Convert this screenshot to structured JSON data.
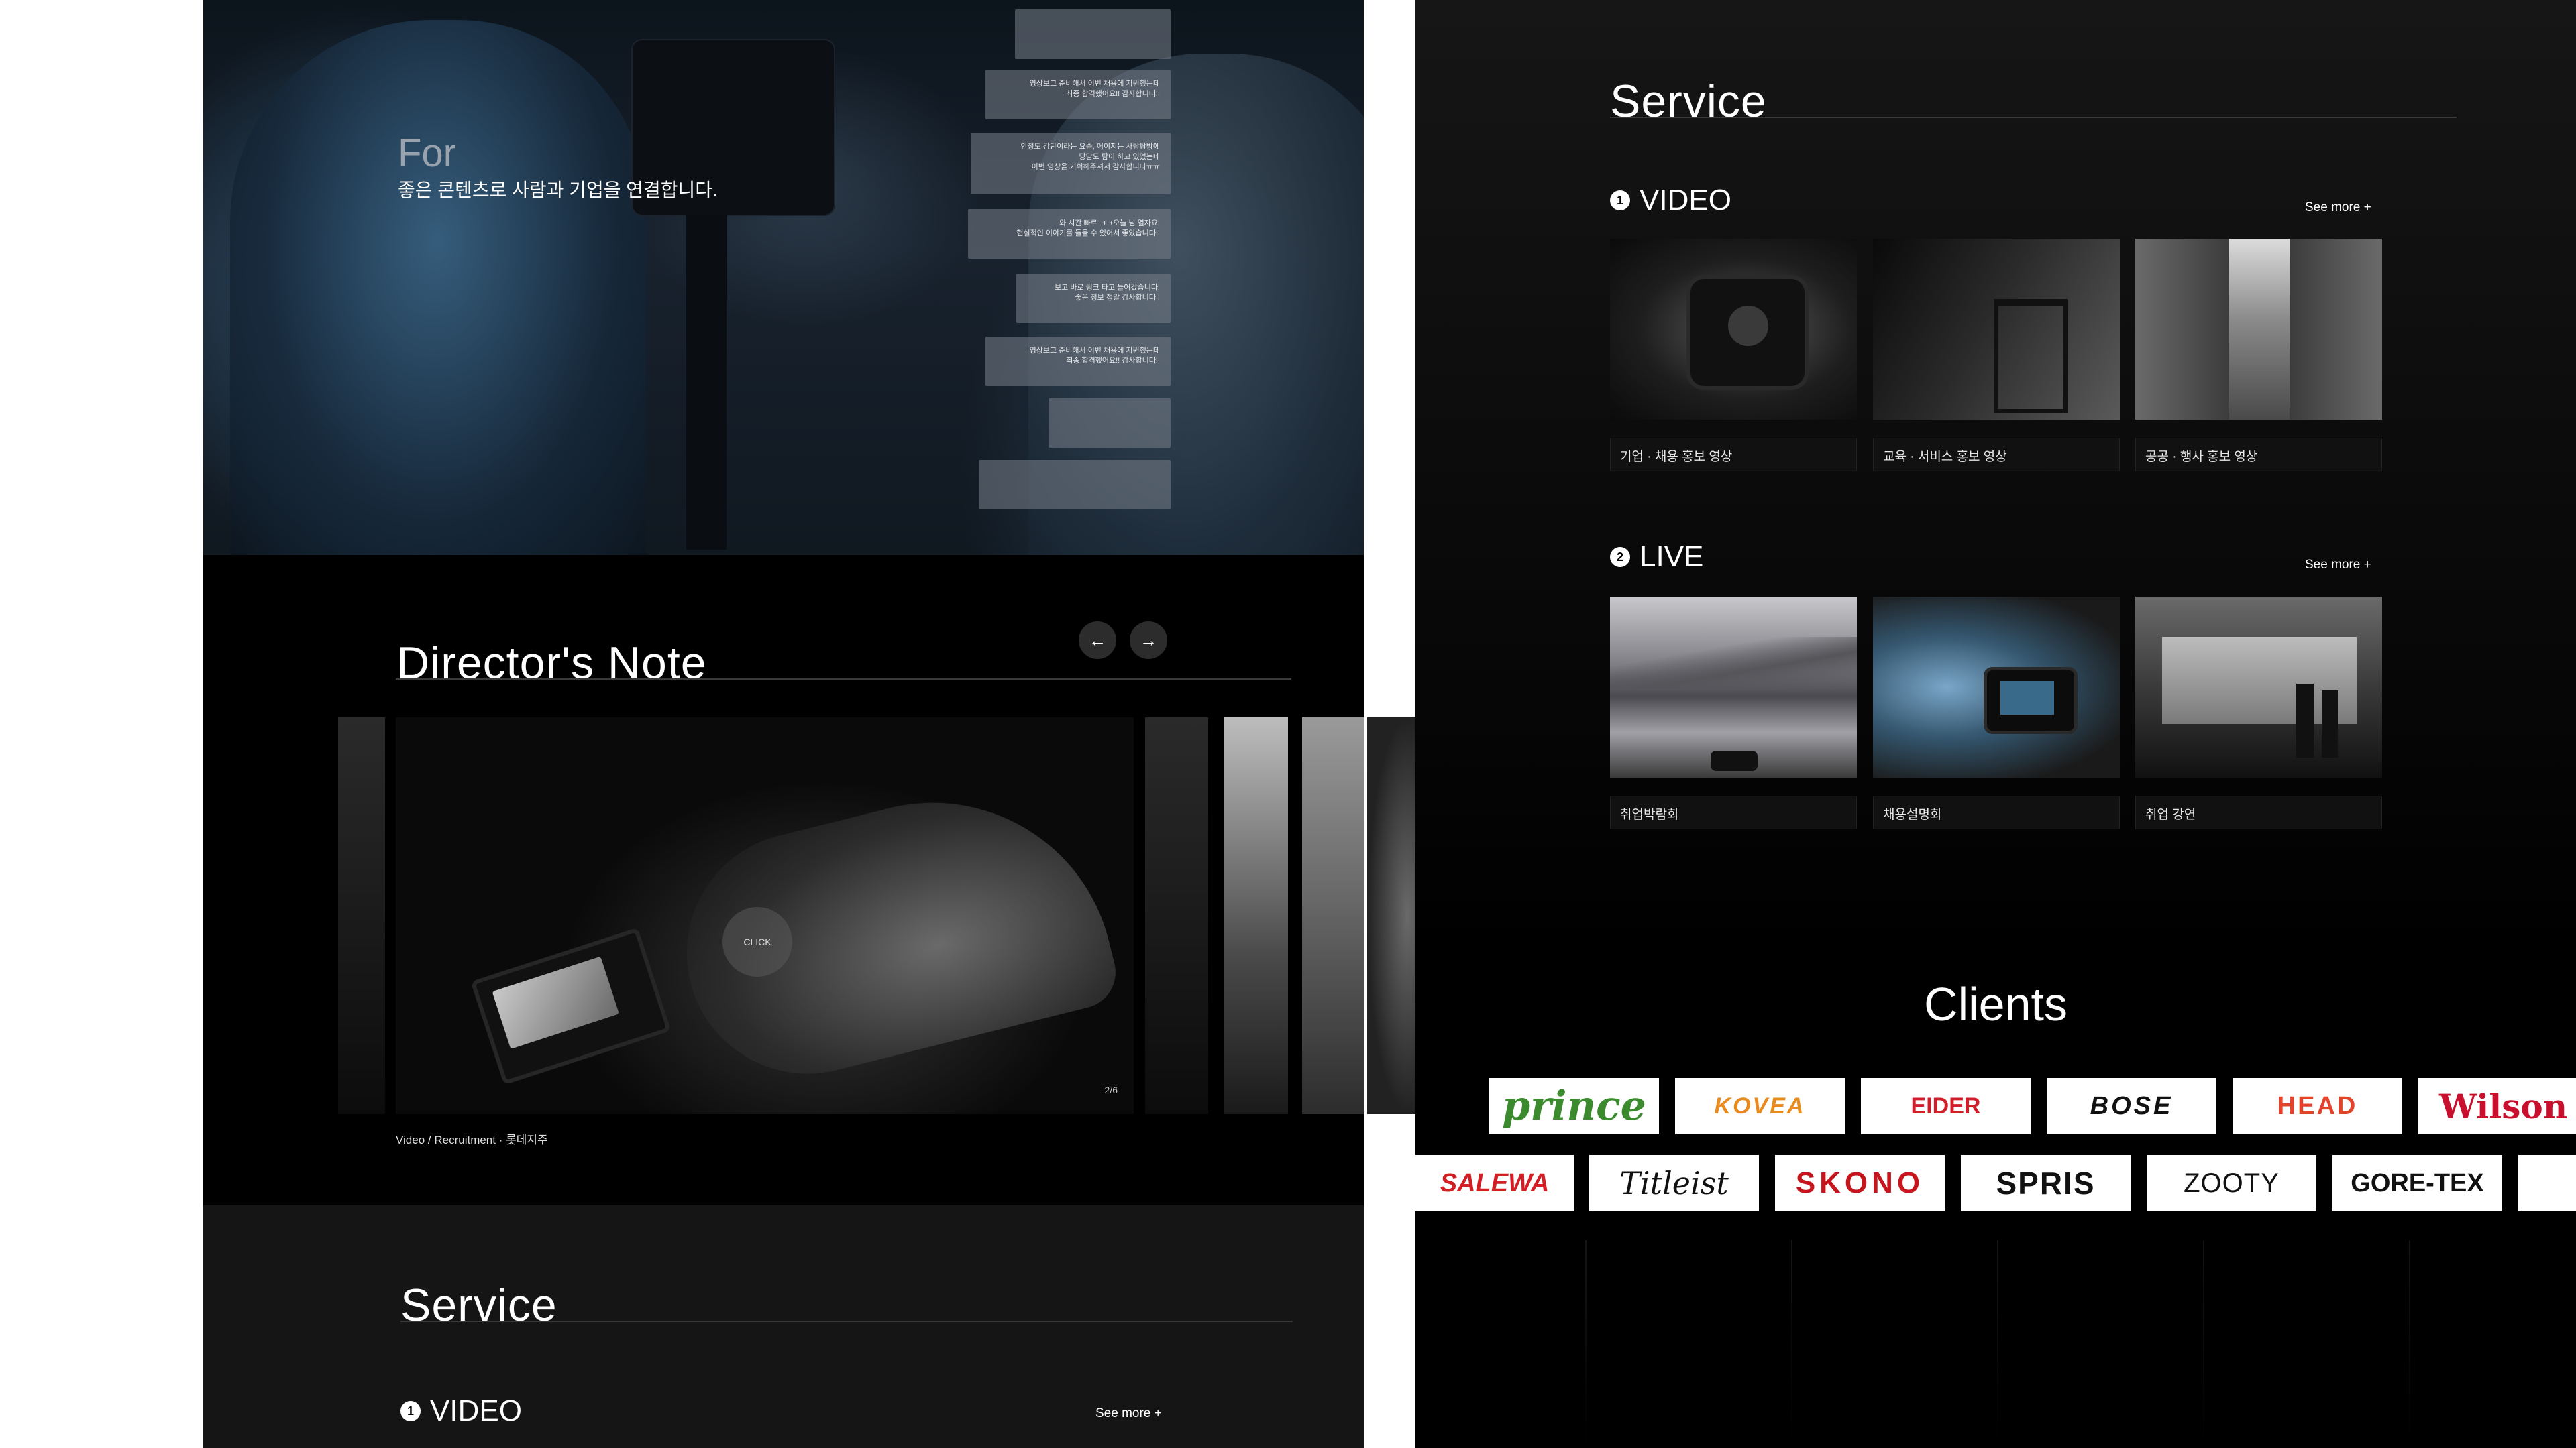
{
  "hero": {
    "for_label": "For",
    "tagline": "좋은 콘텐츠로 사람과 기업을 연결합니다.",
    "bubbles": [
      "영상보고 준비해서 이번 채용에 지원했는데\n최종 합격했어요!! 감사합니다!!",
      "안정도 감탄이라는 요즘, 어이지는 사람탐방에\n당당도 탐이 하고 있었는데\n이번 영상을 기획해주셔서 감사합니다ㅠㅠ",
      "와 시간 빠르 ㅋㅋ오늘 님 열자요!\n현실적인 이야기를 들을 수 있어서 좋았습니다!!",
      "보고 바로 링크 타고 들어갔습니다!\n좋은 정보 정말 감사합니다 !",
      "영상보고 준비해서 이번 채용에 지원했는데\n최종 합격했어요!! 감사합니다!!"
    ]
  },
  "directors_note": {
    "title": "Director's Note",
    "prev_icon": "arrow-left-icon",
    "next_icon": "arrow-right-icon",
    "prev_glyph": "←",
    "next_glyph": "→",
    "click_label": "CLICK",
    "counter": "2/6",
    "caption": "Video / Recruitment · 롯데지주"
  },
  "left_service": {
    "title": "Service",
    "video_num": "1",
    "video_label": "VIDEO",
    "see_more": "See more +"
  },
  "service": {
    "title": "Service",
    "video": {
      "num": "1",
      "label": "VIDEO",
      "see_more": "See more +",
      "items": [
        {
          "label": "기업 · 채용 홍보 영상"
        },
        {
          "label": "교육 · 서비스 홍보 영상"
        },
        {
          "label": "공공 · 행사 홍보 영상"
        }
      ]
    },
    "live": {
      "num": "2",
      "label": "LIVE",
      "see_more": "See more +",
      "items": [
        {
          "label": "취업박람회"
        },
        {
          "label": "채용설명회"
        },
        {
          "label": "취업 강연"
        }
      ]
    }
  },
  "clients": {
    "title": "Clients",
    "row1": [
      {
        "name": "prince",
        "color": "#3b8a2e"
      },
      {
        "name": "KOVEA",
        "color": "#e98a1c"
      },
      {
        "name": "EIDER",
        "color": "#d01e2a"
      },
      {
        "name": "BOSE",
        "color": "#111111"
      },
      {
        "name": "HEAD",
        "color": "#e3422b"
      },
      {
        "name": "Wilson",
        "color": "#c8102e"
      }
    ],
    "row2": [
      {
        "name": "SALEWA",
        "color": "#d21f26"
      },
      {
        "name": "Titleist",
        "color": "#111111"
      },
      {
        "name": "SKONO",
        "color": "#c4161c"
      },
      {
        "name": "SPRIS",
        "color": "#111111"
      },
      {
        "name": "ZOOTY",
        "color": "#111111"
      },
      {
        "name": "GORE-TEX",
        "color": "#111111"
      }
    ]
  },
  "colors": {
    "background": "#000000",
    "panel": "#151515",
    "text": "#ffffff"
  }
}
